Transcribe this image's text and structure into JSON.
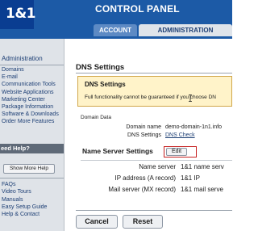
{
  "header": {
    "logo_text": "1&1",
    "title": "CONTROL PANEL",
    "tabs": [
      {
        "label": "ACCOUNT",
        "active": false
      },
      {
        "label": "ADMINISTRATION",
        "active": true
      }
    ]
  },
  "sidebar": {
    "heading": "Administration",
    "items": [
      {
        "label": "Domains"
      },
      {
        "label": "E-mail"
      },
      {
        "label": "Communication Tools"
      },
      {
        "label": "Website Applications"
      },
      {
        "label": "Marketing Center"
      },
      {
        "label": "Package Information"
      },
      {
        "label": "Software & Downloads"
      },
      {
        "label": "Order More Features"
      }
    ],
    "help_heading": "eed Help?",
    "show_more_label": "Show More Help",
    "help_links": [
      {
        "label": "FAQs"
      },
      {
        "label": "Video Tours"
      },
      {
        "label": "Manuals"
      },
      {
        "label": "Easy Setup Guide"
      },
      {
        "label": "Help & Contact"
      }
    ]
  },
  "main": {
    "title": "DNS Settings",
    "warning": {
      "title": "DNS Settings",
      "text": "Full functionality cannot be guaranteed if you choose DN"
    },
    "domain_data": {
      "label": "Domain Data",
      "domain_name_label": "Domain name",
      "domain_name_value": "demo-domain-1n1.info",
      "dns_settings_label": "DNS Settings",
      "dns_settings_value": "DNS Check"
    },
    "name_server_settings": {
      "heading": "Name Server Settings",
      "edit_label": "Edit",
      "rows": [
        {
          "label": "Name server",
          "value": "1&1 name serv"
        },
        {
          "label": "IP address (A record)",
          "value": "1&1 IP"
        },
        {
          "label": "Mail server (MX record)",
          "value": "1&1 mail serve"
        }
      ]
    },
    "actions": {
      "cancel_label": "Cancel",
      "reset_label": "Reset"
    }
  },
  "colors": {
    "header_blue": "#1c5aa6",
    "logo_blue": "#0a3d91",
    "warning_bg": "#fff3c9",
    "highlight_red": "#c62020",
    "link_blue": "#1c3e74"
  }
}
